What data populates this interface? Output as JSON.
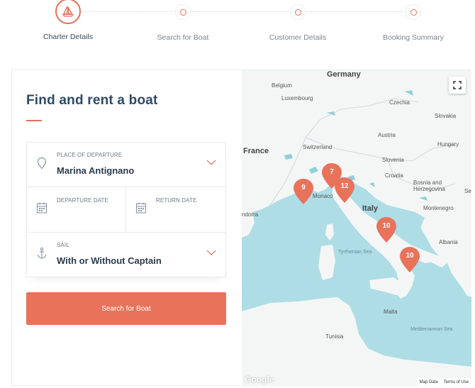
{
  "stepper": {
    "steps": [
      {
        "label": "Charter Details"
      },
      {
        "label": "Search for Boat"
      },
      {
        "label": "Customer Details"
      },
      {
        "label": "Booking Summary"
      }
    ]
  },
  "form": {
    "title": "Find and rent a boat",
    "departure": {
      "label": "PLACE OF DEPARTURE",
      "value": "Marina Antignano"
    },
    "departure_date": {
      "label": "DEPARTURE DATE",
      "value": ""
    },
    "return_date": {
      "label": "RETURN DATE",
      "value": ""
    },
    "sail": {
      "label": "SAIL",
      "value": "With or Without Captain"
    },
    "search_label": "Search for Boat"
  },
  "map": {
    "labels": {
      "germany": "Germany",
      "belgium": "Belgium",
      "luxembourg": "Luxembourg",
      "czechia": "Czechia",
      "slovakia": "Slovakia",
      "austria": "Austria",
      "hungary": "Hungary",
      "france": "France",
      "switzerland": "Switzerland",
      "slovenia": "Slovenia",
      "croatia": "Croatia",
      "bosnia": "Bosnia and Herzegovina",
      "serbia": "Se",
      "montenegro": "Montenegro",
      "italy": "Italy",
      "monaco": "Monaco",
      "andorra": "ndorra",
      "albania": "Albania",
      "tyrrhenian": "Tyrrhenian Sea",
      "malta": "Malta",
      "tunisia": "Tunisia",
      "mediterranean": "Mediterranean Sea"
    },
    "markers": [
      {
        "count": "7"
      },
      {
        "count": "9"
      },
      {
        "count": "12"
      },
      {
        "count": "10"
      },
      {
        "count": "10"
      }
    ],
    "google": "Google",
    "map_data": "Map Data",
    "terms": "Terms of Use"
  },
  "colors": {
    "accent": "#e9725b",
    "title": "#2d4a66",
    "water": "#aedde6",
    "land": "#f4f6f6"
  }
}
